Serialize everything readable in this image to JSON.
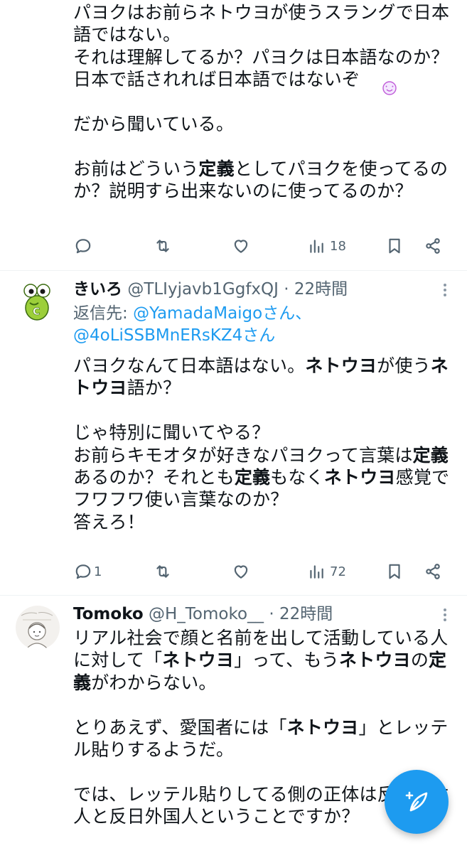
{
  "tweet1": {
    "text_lines": [
      [
        {
          "t": "パヨクはお前らネトウヨが使うスラングで日本"
        }
      ],
      [
        {
          "t": "語ではない。"
        }
      ],
      [
        {
          "t": "それは理解してるか？パヨクは日本語なのか？"
        }
      ],
      [
        {
          "t": "日本で話されれば日本語ではないぞ"
        }
      ],
      [
        {
          "t": ""
        }
      ],
      [
        {
          "t": "だから聞いている。"
        }
      ],
      [
        {
          "t": ""
        }
      ],
      [
        {
          "t": "お前はどういう"
        },
        {
          "t": "定義",
          "b": true
        },
        {
          "t": "としてパヨクを使ってるの"
        }
      ],
      [
        {
          "t": "か？説明すら出来ないのに使ってるのか？"
        }
      ]
    ],
    "views": "18"
  },
  "tweet2": {
    "display_name": "きいろ",
    "meta": "@TLIyjavb1GgfxQJ · 22時間",
    "reply_label": "返信先: ",
    "reply_user1": "@YamadaMaigoさん、",
    "reply_user2": "@4oLiSSBMnERsKZ4さん",
    "text_lines": [
      [
        {
          "t": "パヨクなんて日本語はない。"
        },
        {
          "t": "ネトウヨ",
          "b": true
        },
        {
          "t": "が使う"
        },
        {
          "t": "ネ",
          "b": true
        }
      ],
      [
        {
          "t": "トウヨ",
          "b": true
        },
        {
          "t": "語か？"
        }
      ],
      [
        {
          "t": ""
        }
      ],
      [
        {
          "t": "じゃ特別に聞いてやる？"
        }
      ],
      [
        {
          "t": "お前らキモオタが好きなパヨクって言葉は"
        },
        {
          "t": "定義",
          "b": true
        }
      ],
      [
        {
          "t": "あるのか？それとも"
        },
        {
          "t": "定義",
          "b": true
        },
        {
          "t": "もなく"
        },
        {
          "t": "ネトウヨ",
          "b": true
        },
        {
          "t": "感覚で"
        }
      ],
      [
        {
          "t": "フワフワ使い言葉なのか？"
        }
      ],
      [
        {
          "t": "答えろ！"
        }
      ]
    ],
    "replies": "1",
    "views": "72"
  },
  "tweet3": {
    "display_name": "Tomoko",
    "meta": "@H_Tomoko__ · 22時間",
    "text_lines": [
      [
        {
          "t": "リアル社会で顔と名前を出して活動している人"
        }
      ],
      [
        {
          "t": "に対して「"
        },
        {
          "t": "ネトウヨ",
          "b": true
        },
        {
          "t": "」って、もう"
        },
        {
          "t": "ネトウヨ",
          "b": true
        },
        {
          "t": "の"
        },
        {
          "t": "定",
          "b": true
        }
      ],
      [
        {
          "t": "義",
          "b": true
        },
        {
          "t": "がわからない。"
        }
      ],
      [
        {
          "t": ""
        }
      ],
      [
        {
          "t": "とりあえず、愛国者には「"
        },
        {
          "t": "ネトウヨ",
          "b": true
        },
        {
          "t": "」とレッテ"
        }
      ],
      [
        {
          "t": "ル貼りするようだ。"
        }
      ],
      [
        {
          "t": ""
        }
      ],
      [
        {
          "t": "では、レッテル貼りしてる側の正体は反日日本"
        }
      ],
      [
        {
          "t": "人と反日外国人ということですか？"
        }
      ]
    ]
  },
  "icons": [
    "reply-icon",
    "retweet-icon",
    "like-icon",
    "views-icon",
    "bookmark-icon",
    "share-icon",
    "more-icon",
    "compose-icon"
  ],
  "colors": {
    "accent": "#1d9bf0",
    "secondary_text": "#536471",
    "divider": "#eff3f4"
  }
}
